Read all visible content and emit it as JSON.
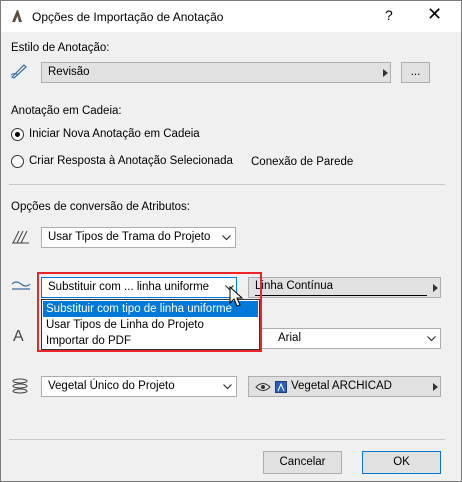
{
  "window": {
    "title": "Opções de Importação de Anotação",
    "help_label": "?",
    "close_label": "✕"
  },
  "annotation_style": {
    "label": "Estilo de Anotação:",
    "value": "Revisão",
    "browse_label": "..."
  },
  "chain": {
    "label": "Anotação em Cadeia:",
    "option_new": "Iniciar Nova Anotação em Cadeia",
    "option_reply": "Criar Resposta à Anotação Selecionada",
    "wall_connection": "Conexão de Parede"
  },
  "attributes": {
    "label": "Opções de conversão de Atributos:",
    "fill_value": "Usar Tipos de Trama do Projeto",
    "line_value": "Substituir com ... linha uniforme",
    "line_type_value": "Linha Contínua",
    "line_options": [
      "Substituir com tipo de linha uniforme",
      "Usar Tipos de Linha do Projeto",
      "Importar do PDF"
    ],
    "font_value": "Arial",
    "surface_value": "Vegetal Único do Projeto",
    "surface_material": "Vegetal ARCHICAD"
  },
  "footer": {
    "cancel_label": "Cancelar",
    "ok_label": "OK"
  },
  "colors": {
    "selection": "#0078d7",
    "highlight": "#e8262c"
  }
}
